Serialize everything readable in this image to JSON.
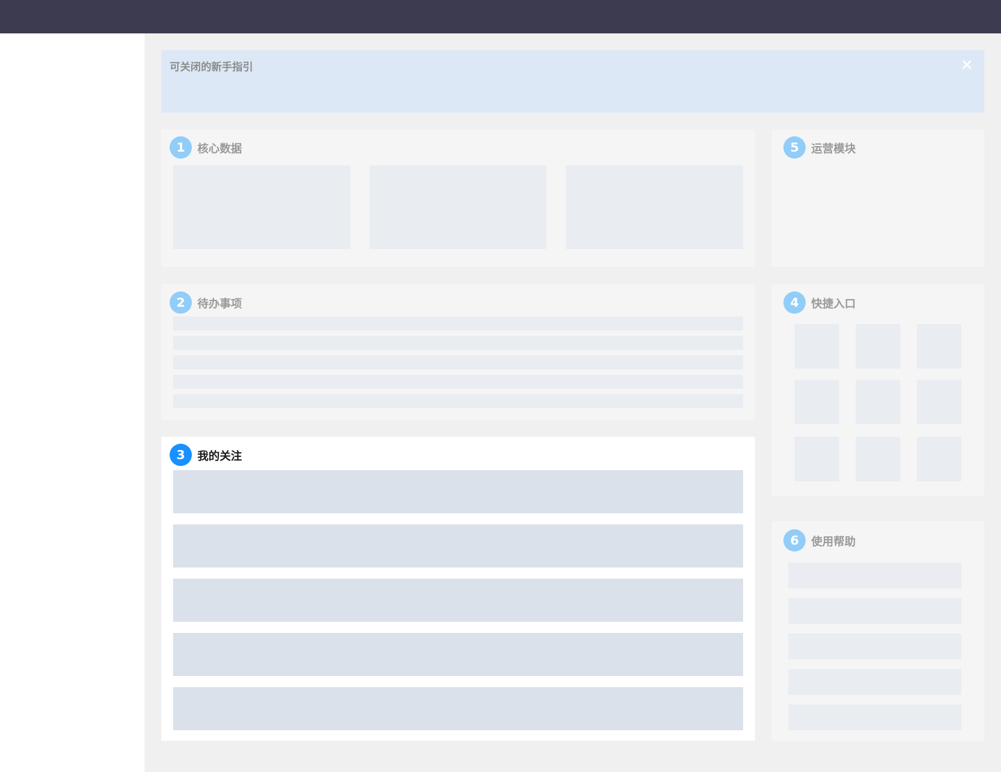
{
  "guide": {
    "title": "可关闭的新手指引",
    "close_glyph": "✕"
  },
  "panels": {
    "core_data": {
      "number": "1",
      "title": "核心数据"
    },
    "todo": {
      "number": "2",
      "title": "待办事项"
    },
    "my_follow": {
      "number": "3",
      "title": "我的关注"
    },
    "quick_entry": {
      "number": "4",
      "title": "快捷入口"
    },
    "operations": {
      "number": "5",
      "title": "运营模块"
    },
    "help": {
      "number": "6",
      "title": "使用帮助"
    }
  },
  "colors": {
    "topbar": "#3d3b4f",
    "guide_bg": "#dde8f6",
    "badge_inactive": "#91cdf8",
    "badge_active": "#1890ff"
  },
  "icons": {
    "close": "close-icon"
  }
}
